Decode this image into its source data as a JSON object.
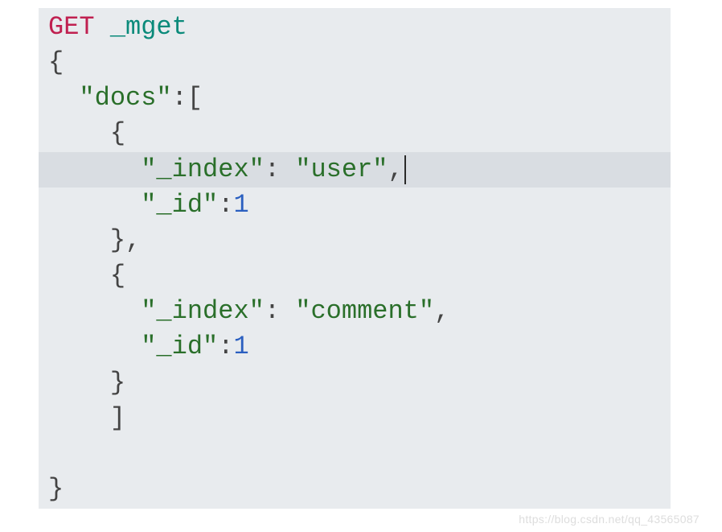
{
  "request": {
    "method": "GET",
    "endpoint": "_mget"
  },
  "body": {
    "open_brace": "{",
    "docs_key": "\"docs\"",
    "colon": ":",
    "open_bracket": "[",
    "item_open": "{",
    "entries": [
      {
        "index_key": "\"_index\"",
        "index_value": "\"user\"",
        "id_key": "\"_id\"",
        "id_value": "1"
      },
      {
        "index_key": "\"_index\"",
        "index_value": "\"comment\"",
        "id_key": "\"_id\"",
        "id_value": "1"
      }
    ],
    "item_close": "}",
    "close_bracket": "]",
    "close_brace": "}",
    "comma": ","
  },
  "watermark": "https://blog.csdn.net/qq_43565087"
}
